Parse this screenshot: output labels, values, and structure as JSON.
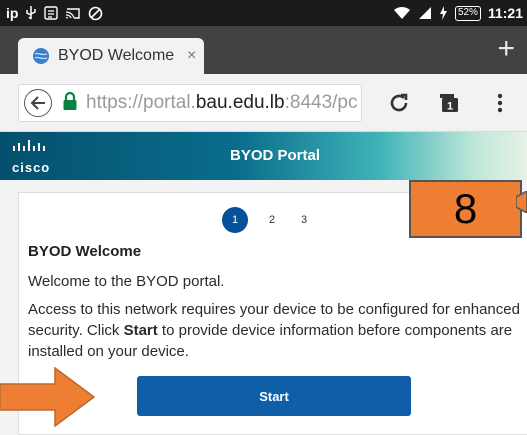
{
  "status_bar": {
    "carrier_label": "ip",
    "battery": "52%",
    "time": "11:21",
    "icons": [
      "usb-icon",
      "notes-icon",
      "cast-icon",
      "vpn-icon",
      "wifi-icon",
      "signal-icon",
      "charging-icon"
    ]
  },
  "browser": {
    "tab_title": "BYOD Welcome",
    "tab_close": "×",
    "new_tab": "+",
    "url_prefix": "https://portal.",
    "url_host": "bau.edu.lb",
    "url_suffix": ":8443/pc",
    "tab_count": "1"
  },
  "header": {
    "brand": "cisco",
    "title": "BYOD Portal"
  },
  "card": {
    "steps": [
      "1",
      "2",
      "3"
    ],
    "active_step": "1",
    "title": "BYOD Welcome",
    "intro": "Welcome to the BYOD portal.",
    "body_before": "Access to this network requires your device to be configured for enhanced security. Click ",
    "body_bold": "Start",
    "body_after": " to provide device information before components are installed on your device.",
    "start_label": "Start"
  },
  "annotations": {
    "step_number": "8"
  },
  "colors": {
    "accent": "#07509a",
    "button": "#0e5fa8",
    "annotation": "#ee7e33",
    "secure_lock": "#0b8043"
  }
}
